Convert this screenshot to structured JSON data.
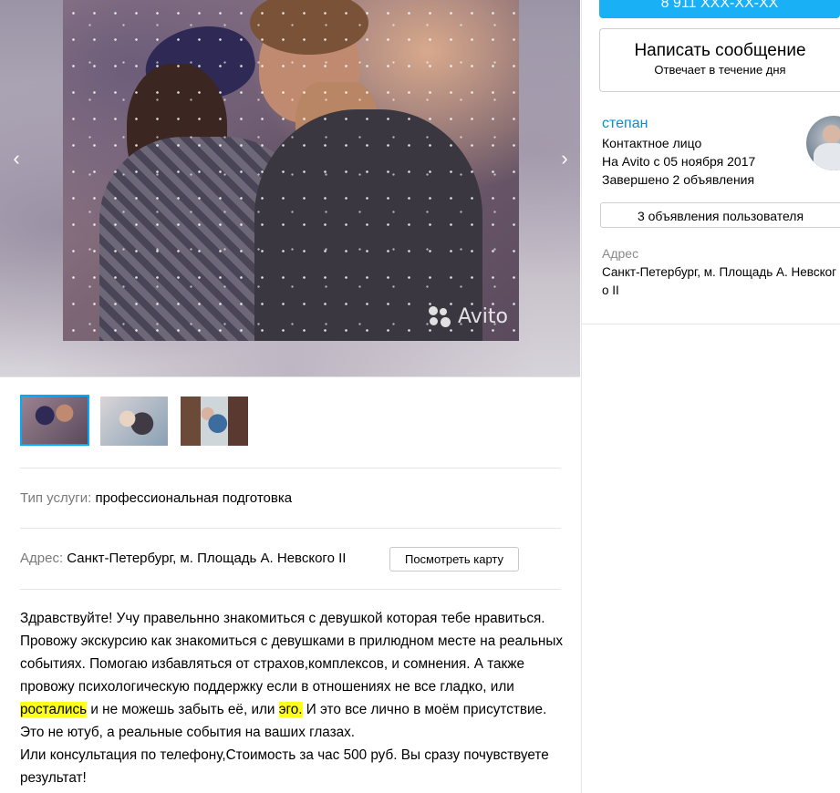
{
  "contact": {
    "phone": "8 911 XXX-XX-XX",
    "message_title": "Написать сообщение",
    "message_subtitle": "Отвечает в течение дня"
  },
  "seller": {
    "name": "степан",
    "role": "Контактное лицо",
    "since": "На Avito с 05 ноября 2017",
    "completed": "Завершено 2 объявления",
    "ads_button": "3 объявления пользователя",
    "address_label": "Адрес",
    "address": "Санкт-Петербург, м. Площадь А. Невского II"
  },
  "gallery": {
    "watermark": "Avito",
    "prev_icon": "chevron-left-icon",
    "next_icon": "chevron-right-icon",
    "thumbnail_count": 3,
    "active_thumbnail": 1
  },
  "params": {
    "service_label": "Тип услуги:",
    "service_value": "профессиональная подготовка",
    "address_label": "Адрес:",
    "address_value": "Санкт-Петербург, м. Площадь А. Невского II",
    "map_button": "Посмотреть карту"
  },
  "description": {
    "part1": "Здравствуйте! Учу правельнно знакомиться с девушкой которая тебе нравиться. Провожу экскурсию как знакомиться с девушками в прилюдном месте на реальных событиях. Помогаю избавляться от страхов,комплексов, и сомнения. А также провожу психологическую поддержку если в отношениях не все гладко, или ",
    "highlight1": "рocтались",
    "part2": " и не можешь забыть её, или ",
    "highlight2": "эго.",
    "part3": " И это все лично в моём присутствие. Это не ютуб, а реальные события на ваших глазах.",
    "line2": "Или консультация по телефону,Стоимость за час 500 руб. Вы сразу почувствуете результат!"
  },
  "colors": {
    "accent": "#00aaff",
    "phone_button": "#1ab0f5",
    "link": "#0091d9",
    "highlight": "#ffff1a"
  }
}
